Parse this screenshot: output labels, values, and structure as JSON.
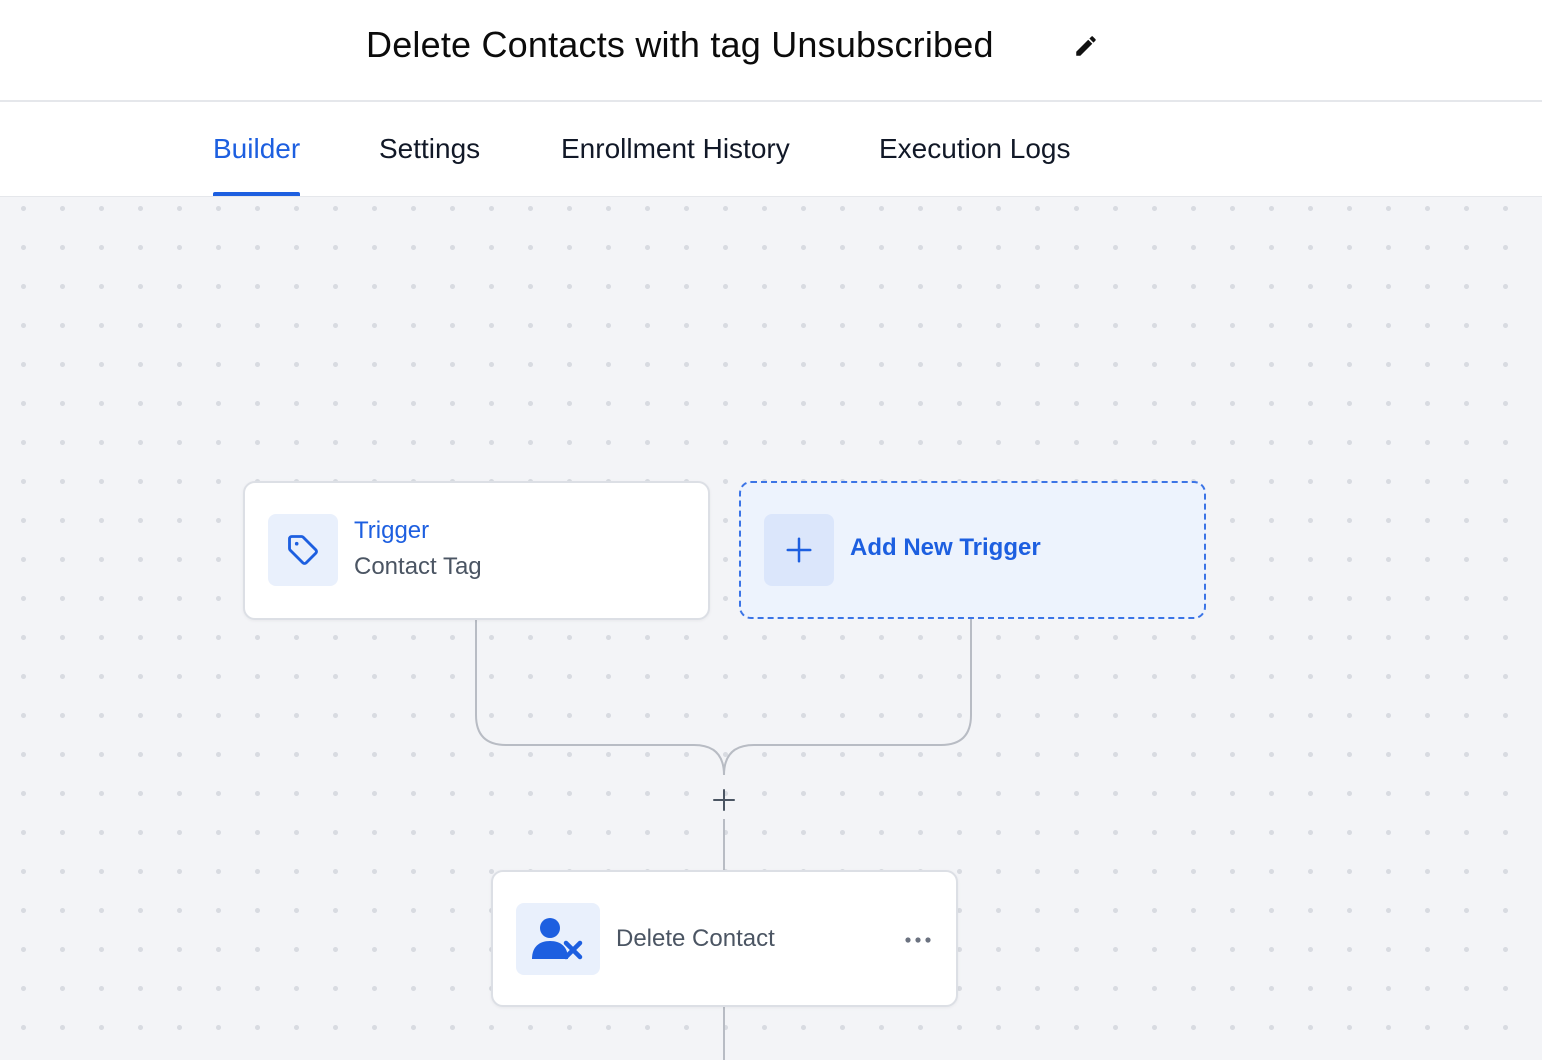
{
  "header": {
    "title": "Delete Contacts with tag Unsubscribed",
    "edit_icon": "pencil-icon"
  },
  "tabs": [
    {
      "label": "Builder",
      "active": true
    },
    {
      "label": "Settings",
      "active": false
    },
    {
      "label": "Enrollment History",
      "active": false
    },
    {
      "label": "Execution Logs",
      "active": false
    }
  ],
  "workflow": {
    "trigger": {
      "title": "Trigger",
      "subtitle": "Contact Tag",
      "icon": "tag-icon"
    },
    "add_trigger": {
      "label": "Add New Trigger",
      "icon": "plus-icon"
    },
    "add_step_icon": "plus-icon",
    "action": {
      "label": "Delete Contact",
      "icon": "user-delete-icon",
      "menu_icon": "more-horizontal-icon"
    }
  },
  "colors": {
    "accent": "#1d5fe0",
    "accent_light": "#e9f0fc",
    "canvas_bg": "#f3f4f7",
    "connector": "#b8bcc4"
  }
}
